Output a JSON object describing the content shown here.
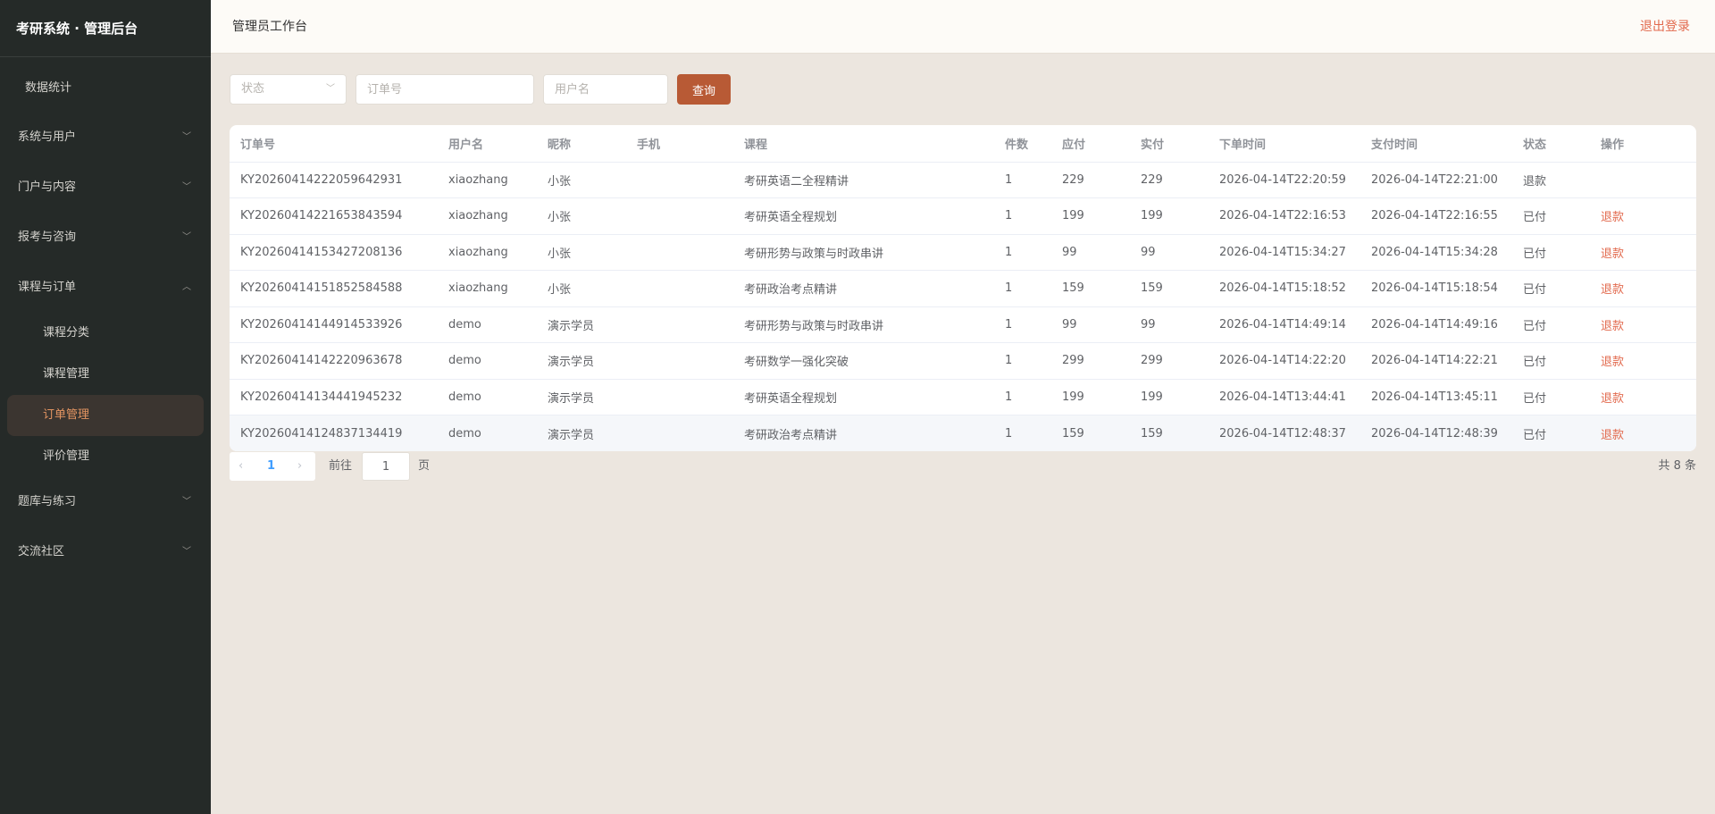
{
  "sidebar": {
    "brand": "考研系统 · 管理后台",
    "top_item": "数据统计",
    "groups": [
      {
        "label": "系统与用户"
      },
      {
        "label": "门户与内容"
      },
      {
        "label": "报考与咨询"
      },
      {
        "label": "课程与订单",
        "expanded": true,
        "children": [
          "课程分类",
          "课程管理",
          "订单管理",
          "评价管理"
        ],
        "active_child": "订单管理"
      },
      {
        "label": "题库与练习"
      },
      {
        "label": "交流社区"
      }
    ]
  },
  "header": {
    "title": "管理员工作台",
    "logout": "退出登录"
  },
  "filters": {
    "status_placeholder": "状态",
    "order_no_placeholder": "订单号",
    "username_placeholder": "用户名",
    "query_label": "查询"
  },
  "table": {
    "columns": [
      "订单号",
      "用户名",
      "昵称",
      "手机",
      "课程",
      "件数",
      "应付",
      "实付",
      "下单时间",
      "支付时间",
      "状态",
      "操作"
    ],
    "rows": [
      {
        "order_no": "KY20260414222059642931",
        "username": "xiaozhang",
        "nickname": "小张",
        "phone": "",
        "course": "考研英语二全程精讲",
        "qty": "1",
        "payable": "229",
        "paid": "229",
        "created": "2026-04-14T22:20:59",
        "paid_at": "2026-04-14T22:21:00",
        "status": "退款",
        "action": ""
      },
      {
        "order_no": "KY20260414221653843594",
        "username": "xiaozhang",
        "nickname": "小张",
        "phone": "",
        "course": "考研英语全程规划",
        "qty": "1",
        "payable": "199",
        "paid": "199",
        "created": "2026-04-14T22:16:53",
        "paid_at": "2026-04-14T22:16:55",
        "status": "已付",
        "action": "退款"
      },
      {
        "order_no": "KY20260414153427208136",
        "username": "xiaozhang",
        "nickname": "小张",
        "phone": "",
        "course": "考研形势与政策与时政串讲",
        "qty": "1",
        "payable": "99",
        "paid": "99",
        "created": "2026-04-14T15:34:27",
        "paid_at": "2026-04-14T15:34:28",
        "status": "已付",
        "action": "退款"
      },
      {
        "order_no": "KY20260414151852584588",
        "username": "xiaozhang",
        "nickname": "小张",
        "phone": "",
        "course": "考研政治考点精讲",
        "qty": "1",
        "payable": "159",
        "paid": "159",
        "created": "2026-04-14T15:18:52",
        "paid_at": "2026-04-14T15:18:54",
        "status": "已付",
        "action": "退款"
      },
      {
        "order_no": "KY20260414144914533926",
        "username": "demo",
        "nickname": "演示学员",
        "phone": "",
        "course": "考研形势与政策与时政串讲",
        "qty": "1",
        "payable": "99",
        "paid": "99",
        "created": "2026-04-14T14:49:14",
        "paid_at": "2026-04-14T14:49:16",
        "status": "已付",
        "action": "退款"
      },
      {
        "order_no": "KY20260414142220963678",
        "username": "demo",
        "nickname": "演示学员",
        "phone": "",
        "course": "考研数学一强化突破",
        "qty": "1",
        "payable": "299",
        "paid": "299",
        "created": "2026-04-14T14:22:20",
        "paid_at": "2026-04-14T14:22:21",
        "status": "已付",
        "action": "退款"
      },
      {
        "order_no": "KY20260414134441945232",
        "username": "demo",
        "nickname": "演示学员",
        "phone": "",
        "course": "考研英语全程规划",
        "qty": "1",
        "payable": "199",
        "paid": "199",
        "created": "2026-04-14T13:44:41",
        "paid_at": "2026-04-14T13:45:11",
        "status": "已付",
        "action": "退款"
      },
      {
        "order_no": "KY20260414124837134419",
        "username": "demo",
        "nickname": "演示学员",
        "phone": "",
        "course": "考研政治考点精讲",
        "qty": "1",
        "payable": "159",
        "paid": "159",
        "created": "2026-04-14T12:48:37",
        "paid_at": "2026-04-14T12:48:39",
        "status": "已付",
        "action": "退款"
      }
    ]
  },
  "pagination": {
    "prev_icon": "‹",
    "current_page": "1",
    "next_icon": "›",
    "goto_label": "前往",
    "goto_value": "1",
    "goto_suffix": "页",
    "total": "共 8 条"
  },
  "colors": {
    "sidebar_bg": "#252a28",
    "active_text": "#e49562",
    "accent_button": "#b85a35",
    "danger_link": "#e26a4e",
    "page_bg": "#ece6df"
  }
}
